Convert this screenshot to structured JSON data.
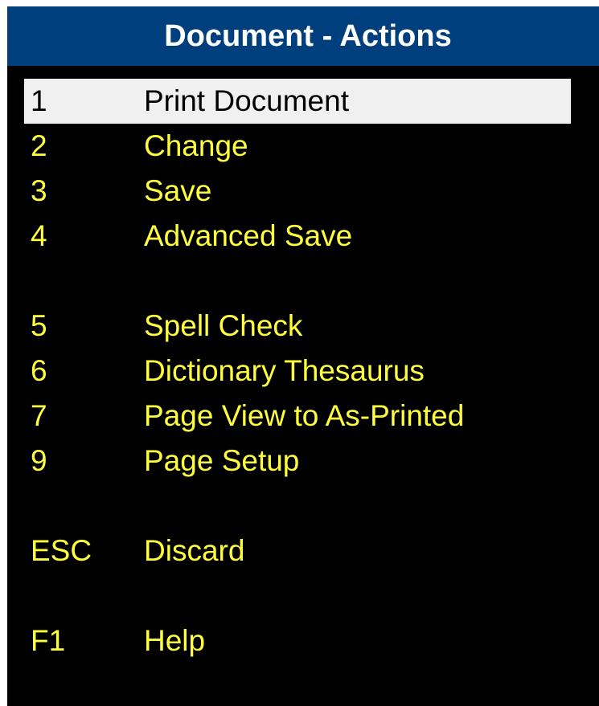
{
  "window": {
    "title": "Document - Actions"
  },
  "menu": {
    "items": [
      {
        "key": "1",
        "label": "Print Document",
        "selected": true
      },
      {
        "key": "2",
        "label": "Change"
      },
      {
        "key": "3",
        "label": "Save"
      },
      {
        "key": "4",
        "label": "Advanced Save"
      },
      {
        "key": "5",
        "label": "Spell Check"
      },
      {
        "key": "6",
        "label": "Dictionary Thesaurus"
      },
      {
        "key": "7",
        "label": "Page View to As-Printed"
      },
      {
        "key": "9",
        "label": "Page Setup"
      },
      {
        "key": "ESC",
        "label": "Discard"
      },
      {
        "key": "F1",
        "label": "Help"
      }
    ]
  },
  "colors": {
    "title_bar": "#003f7d",
    "background": "#000000",
    "item_text": "#ffff3c",
    "selected_background": "#f0f0f0",
    "selected_text": "#000000"
  }
}
